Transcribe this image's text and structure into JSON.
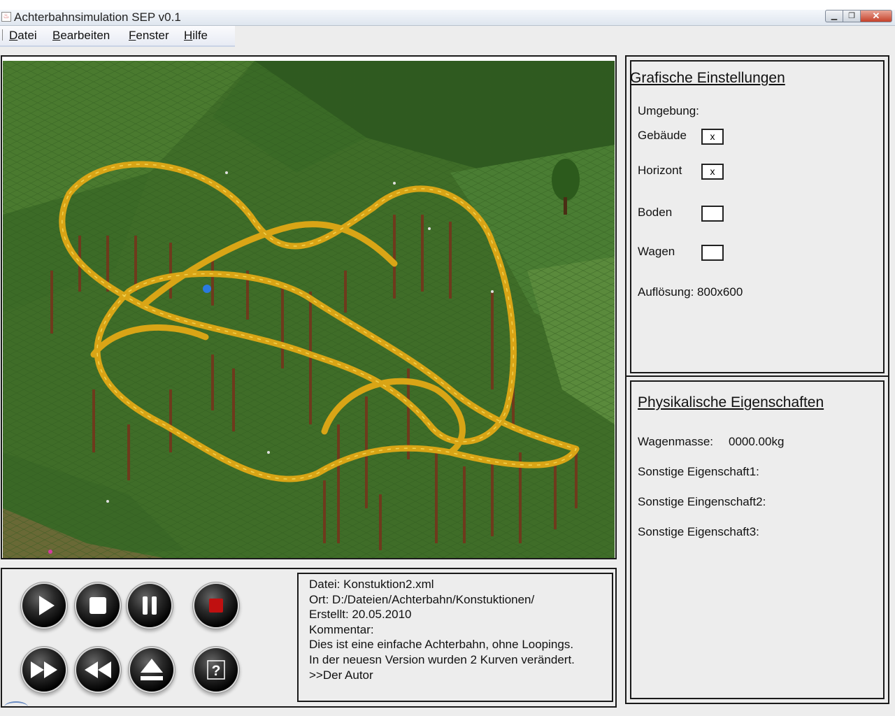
{
  "window": {
    "title": "Achterbahnsimulation SEP v0.1",
    "controls": [
      "minimize",
      "restore",
      "close"
    ]
  },
  "menu": [
    {
      "label": "Datei",
      "mnemonic": "D",
      "rest": "atei"
    },
    {
      "label": "Bearbeiten",
      "mnemonic": "B",
      "rest": "earbeiten"
    },
    {
      "label": "Fenster",
      "mnemonic": "F",
      "rest": "enster"
    },
    {
      "label": "Hilfe",
      "mnemonic": "H",
      "rest": "ilfe"
    }
  ],
  "graphics": {
    "heading": "Grafische Einstellungen",
    "environment_label": "Umgebung:",
    "options": [
      {
        "label": "Gebäude",
        "checked": true,
        "mark": "x"
      },
      {
        "label": "Horizont",
        "checked": true,
        "mark": "x"
      },
      {
        "label": "Boden",
        "checked": false,
        "mark": ""
      },
      {
        "label": "Wagen",
        "checked": false,
        "mark": ""
      }
    ],
    "resolution": "Auflösung: 800x600"
  },
  "physics": {
    "heading": "Physikalische Eigenschaften",
    "mass_label": "Wagenmasse:",
    "mass_value": "0000.00kg",
    "other": [
      "Sonstige Eigenschaft1:",
      "Sonstige Eingenschaft2:",
      "Sonstige Eigenschaft3:"
    ]
  },
  "playback": {
    "buttons": [
      "play",
      "stop",
      "pause",
      "record",
      "fast-forward",
      "rewind",
      "eject",
      "help"
    ]
  },
  "info": {
    "lines": [
      "Datei: Konstuktion2.xml",
      "Ort: D:/Dateien/Achterbahn/Konstuktionen/",
      "Erstellt: 20.05.2010",
      "Kommentar:",
      "Dies ist eine einfache Achterbahn, ohne Loopings.",
      "In der neuesn Version wurden 2 Kurven verändert.",
      ">>Der Autor"
    ]
  },
  "colors": {
    "grass": "#3f6d28",
    "track": "#d9a516",
    "support": "#6e3a1c",
    "record_red": "#c01010"
  },
  "scene": {
    "description_icon": "roller-coaster-scene"
  }
}
